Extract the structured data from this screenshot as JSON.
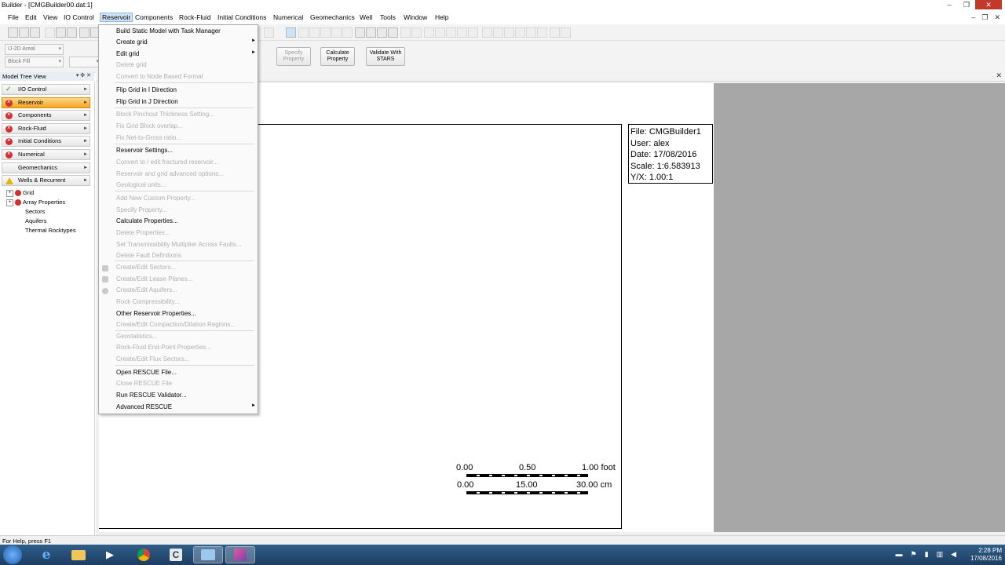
{
  "window": {
    "title": "Builder - [CMGBuilder00.dat:1]",
    "controls": {
      "minimize": "–",
      "restore": "❐",
      "close": "✕"
    }
  },
  "menubar": {
    "items": [
      "File",
      "Edit",
      "View",
      "IO Control",
      "Reservoir",
      "Components",
      "Rock-Fluid",
      "Initial Conditions",
      "Numerical",
      "Geomechanics",
      "Well",
      "Tools",
      "Window",
      "Help"
    ],
    "mdi_controls": {
      "minimize": "–",
      "restore": "❐",
      "close": "✕"
    }
  },
  "toolbar2": {
    "view_combo": "IJ-2D Areal",
    "fill_combo": "Block Fill",
    "specify_property": "Specify Property",
    "calculate_property": "Calculate Property",
    "validate_stars": "Validate With STARS"
  },
  "model_tree": {
    "title": "Model Tree View",
    "header_controls": {
      "dropdown": "▾",
      "pin": "✜",
      "close": "✕"
    },
    "nodes": [
      {
        "label": "I/O Control",
        "status": "ok"
      },
      {
        "label": "Reservoir",
        "status": "error"
      },
      {
        "label": "Components",
        "status": "error"
      },
      {
        "label": "Rock-Fluid",
        "status": "error"
      },
      {
        "label": "Initial Conditions",
        "status": "error"
      },
      {
        "label": "Numerical",
        "status": "error"
      },
      {
        "label": "Geomechanics",
        "status": "none"
      },
      {
        "label": "Wells & Recurrent",
        "status": "warn"
      }
    ],
    "children": [
      "Grid",
      "Array Properties",
      "Sectors",
      "Aquifers",
      "Thermal Rocktypes"
    ]
  },
  "reservoir_menu": {
    "items": [
      {
        "label": "Build Static Model with Task Manager",
        "enabled": true,
        "submenu": false
      },
      {
        "label": "Create grid",
        "enabled": true,
        "submenu": true
      },
      {
        "label": "Edit grid",
        "enabled": true,
        "submenu": true
      },
      {
        "label": "Delete grid",
        "enabled": false,
        "submenu": false
      },
      {
        "label": "Convert to Node Based Format",
        "enabled": false,
        "submenu": false
      },
      {
        "label": "Flip Grid in I Direction",
        "enabled": true,
        "submenu": false
      },
      {
        "label": "Flip Grid in J Direction",
        "enabled": true,
        "submenu": false
      },
      {
        "label": "Block Pinchout Thickness Setting...",
        "enabled": false,
        "submenu": false
      },
      {
        "label": "Fix Grid Block overlap...",
        "enabled": false,
        "submenu": false
      },
      {
        "label": "Fix Net-to-Gross ratio...",
        "enabled": false,
        "submenu": false
      },
      {
        "label": "Reservoir Settings...",
        "enabled": true,
        "submenu": false
      },
      {
        "label": "Convert to / edit fractured reservoir...",
        "enabled": false,
        "submenu": false
      },
      {
        "label": "Reservoir and grid advanced options...",
        "enabled": false,
        "submenu": false
      },
      {
        "label": "Geological units...",
        "enabled": false,
        "submenu": false
      },
      {
        "label": "Add New Custom Property...",
        "enabled": false,
        "submenu": false
      },
      {
        "label": "Specify Property...",
        "enabled": false,
        "submenu": false
      },
      {
        "label": "Calculate Properties...",
        "enabled": true,
        "submenu": false
      },
      {
        "label": "Delete Properties...",
        "enabled": false,
        "submenu": false
      },
      {
        "label": "Set Transmissibility Multiplier Across Faults...",
        "enabled": false,
        "submenu": false
      },
      {
        "label": "Delete Fault Definitions",
        "enabled": false,
        "submenu": false
      },
      {
        "label": "Create/Edit Sectors...",
        "enabled": false,
        "submenu": false
      },
      {
        "label": "Create/Edit Lease Planes...",
        "enabled": false,
        "submenu": false
      },
      {
        "label": "Create/Edit Aquifers...",
        "enabled": false,
        "submenu": false
      },
      {
        "label": "Rock Compressibility...",
        "enabled": false,
        "submenu": false
      },
      {
        "label": "Other Reservoir Properties...",
        "enabled": true,
        "submenu": false
      },
      {
        "label": "Create/Edit Compaction/Dilation Regions...",
        "enabled": false,
        "submenu": false
      },
      {
        "label": "Geostatistics...",
        "enabled": false,
        "submenu": false
      },
      {
        "label": "Rock-Fluid End-Point Properties...",
        "enabled": false,
        "submenu": false
      },
      {
        "label": "Create/Edit Flux Sectors...",
        "enabled": false,
        "submenu": false
      },
      {
        "label": "Open RESCUE File...",
        "enabled": true,
        "submenu": false
      },
      {
        "label": "Close RESCUE File",
        "enabled": false,
        "submenu": false
      },
      {
        "label": "Run RESCUE Validator...",
        "enabled": true,
        "submenu": false
      },
      {
        "label": "Advanced RESCUE",
        "enabled": true,
        "submenu": true
      }
    ]
  },
  "document": {
    "close": "✕",
    "info": {
      "file": "File: CMGBuilder1",
      "user": "User:  alex",
      "date": "Date: 17/08/2016",
      "scale": "Scale: 1:6.583913",
      "yx": "Y/X: 1.00:1"
    },
    "scale_foot": {
      "a": "0.00",
      "b": "0.50",
      "c": "1.00 foot"
    },
    "scale_cm": {
      "a": "0.00",
      "b": "15.00",
      "c": "30.00 cm"
    }
  },
  "statusbar": {
    "text": "For Help, press F1"
  },
  "taskbar": {
    "time": "2:28 PM",
    "date": "17/08/2016",
    "apps": [
      "internet-explorer",
      "file-explorer",
      "media-player",
      "chrome",
      "cmg-launcher",
      "cmg-builder",
      "app-7"
    ]
  }
}
